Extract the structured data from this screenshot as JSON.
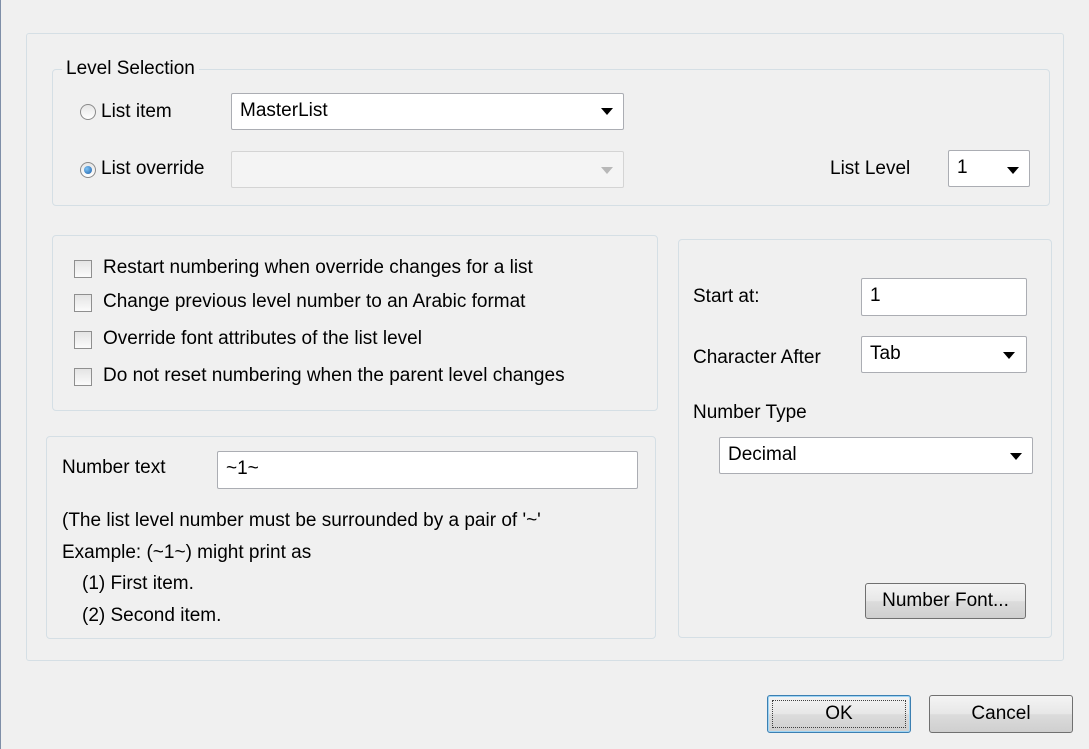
{
  "level_selection": {
    "legend": "Level Selection",
    "list_item_label": "List item",
    "list_item_value": "MasterList",
    "list_override_label": "List override",
    "list_override_value": "",
    "list_level_label": "List Level",
    "list_level_value": "1",
    "selected_option": "list_override"
  },
  "options": {
    "checkboxes": [
      {
        "label": "Restart numbering when override changes for a list",
        "checked": false
      },
      {
        "label": "Change previous level number to an Arabic format",
        "checked": false
      },
      {
        "label": "Override font attributes of the list level",
        "checked": false
      },
      {
        "label": "Do not reset numbering when the parent level changes",
        "checked": false
      }
    ]
  },
  "number_text": {
    "label": "Number text",
    "value": "~1~",
    "help_lines": [
      "(The list level number must be surrounded by a pair of '~'",
      "Example:  (~1~) might print as",
      "(1) First item.",
      "(2) Second item."
    ]
  },
  "format": {
    "start_at_label": "Start at:",
    "start_at_value": "1",
    "character_after_label": "Character After",
    "character_after_value": "Tab",
    "number_type_label": "Number Type",
    "number_type_value": "Decimal",
    "number_font_button": "Number Font..."
  },
  "footer": {
    "ok_label": "OK",
    "cancel_label": "Cancel"
  },
  "colors": {
    "background": "#f0f0f0",
    "group_border": "#d5dfe5",
    "default_button_border": "#3c7fb1"
  }
}
